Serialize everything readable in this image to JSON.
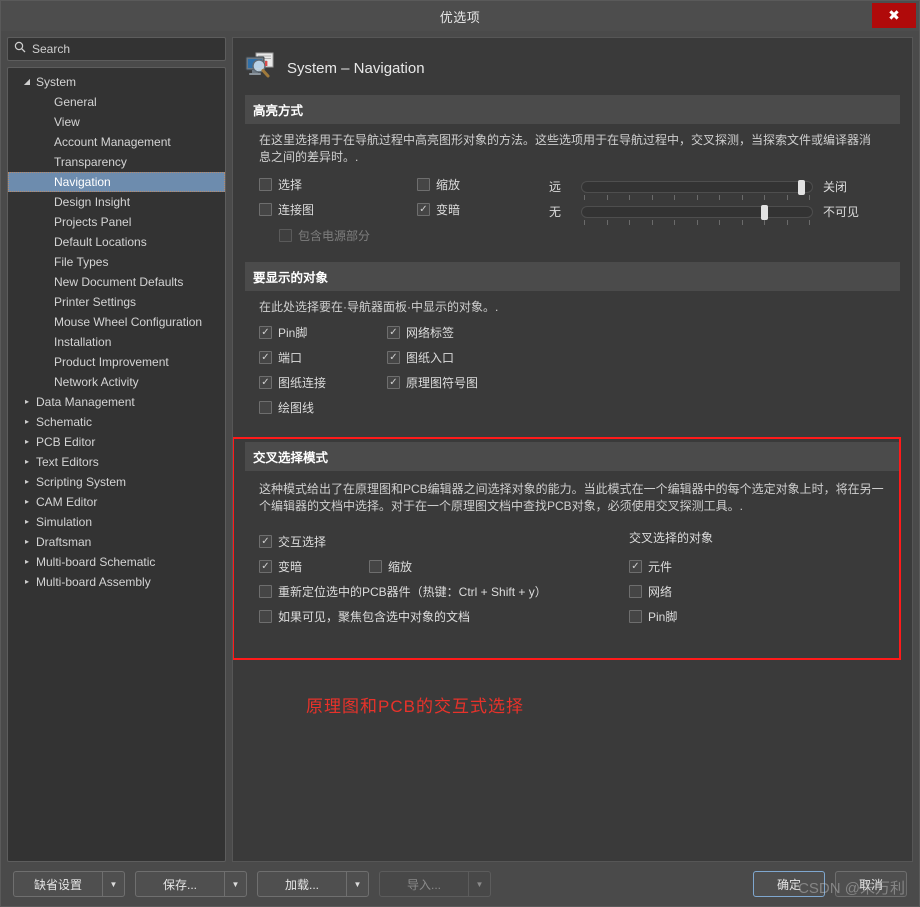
{
  "window": {
    "title": "优选项",
    "close_label": "✖"
  },
  "search": {
    "placeholder": "Search",
    "value": "",
    "icon": "search-icon"
  },
  "sidebar": {
    "items": [
      {
        "label": "System",
        "level": 0,
        "caret": "◢",
        "selected": false
      },
      {
        "label": "General",
        "level": 1,
        "caret": "",
        "selected": false
      },
      {
        "label": "View",
        "level": 1,
        "caret": "",
        "selected": false
      },
      {
        "label": "Account Management",
        "level": 1,
        "caret": "",
        "selected": false
      },
      {
        "label": "Transparency",
        "level": 1,
        "caret": "",
        "selected": false
      },
      {
        "label": "Navigation",
        "level": 1,
        "caret": "",
        "selected": true
      },
      {
        "label": "Design Insight",
        "level": 1,
        "caret": "",
        "selected": false
      },
      {
        "label": "Projects Panel",
        "level": 1,
        "caret": "",
        "selected": false
      },
      {
        "label": "Default Locations",
        "level": 1,
        "caret": "",
        "selected": false
      },
      {
        "label": "File Types",
        "level": 1,
        "caret": "",
        "selected": false
      },
      {
        "label": "New Document Defaults",
        "level": 1,
        "caret": "",
        "selected": false
      },
      {
        "label": "Printer Settings",
        "level": 1,
        "caret": "",
        "selected": false
      },
      {
        "label": "Mouse Wheel Configuration",
        "level": 1,
        "caret": "",
        "selected": false
      },
      {
        "label": "Installation",
        "level": 1,
        "caret": "",
        "selected": false
      },
      {
        "label": "Product Improvement",
        "level": 1,
        "caret": "",
        "selected": false
      },
      {
        "label": "Network Activity",
        "level": 1,
        "caret": "",
        "selected": false
      },
      {
        "label": "Data Management",
        "level": 0,
        "caret": "▸",
        "selected": false
      },
      {
        "label": "Schematic",
        "level": 0,
        "caret": "▸",
        "selected": false
      },
      {
        "label": "PCB Editor",
        "level": 0,
        "caret": "▸",
        "selected": false
      },
      {
        "label": "Text Editors",
        "level": 0,
        "caret": "▸",
        "selected": false
      },
      {
        "label": "Scripting System",
        "level": 0,
        "caret": "▸",
        "selected": false
      },
      {
        "label": "CAM Editor",
        "level": 0,
        "caret": "▸",
        "selected": false
      },
      {
        "label": "Simulation",
        "level": 0,
        "caret": "▸",
        "selected": false
      },
      {
        "label": "Draftsman",
        "level": 0,
        "caret": "▸",
        "selected": false
      },
      {
        "label": "Multi-board Schematic",
        "level": 0,
        "caret": "▸",
        "selected": false
      },
      {
        "label": "Multi-board Assembly",
        "level": 0,
        "caret": "▸",
        "selected": false
      }
    ]
  },
  "page": {
    "title": "System – Navigation",
    "icon": "monitor-magnifier-icon"
  },
  "highlight_section": {
    "header": "高亮方式",
    "description": "在这里选择用于在导航过程中高亮图形对象的方法。这些选项用于在导航过程中，交叉探测，当探索文件或编译器消息之间的差异时。.",
    "col_a": [
      {
        "label": "选择",
        "checked": false,
        "disabled": false
      },
      {
        "label": "连接图",
        "checked": false,
        "disabled": false
      }
    ],
    "col_b": [
      {
        "label": "缩放",
        "checked": false,
        "disabled": false
      },
      {
        "label": "变暗",
        "checked": true,
        "disabled": false
      }
    ],
    "sub_option": {
      "label": "包含电源部分",
      "checked": false,
      "disabled": true
    },
    "sliders": [
      {
        "left_label": "远",
        "right_label": "关闭",
        "value_pct": 96
      },
      {
        "left_label": "无",
        "right_label": "不可见",
        "value_pct": 80
      }
    ]
  },
  "objects_section": {
    "header": "要显示的对象",
    "description": "在此处选择要在·导航器面板·中显示的对象。.",
    "col_a": [
      {
        "label": "Pin脚",
        "checked": true
      },
      {
        "label": "端口",
        "checked": true
      },
      {
        "label": "图纸连接",
        "checked": true
      },
      {
        "label": "绘图线",
        "checked": false
      }
    ],
    "col_b": [
      {
        "label": "网络标签",
        "checked": true
      },
      {
        "label": "图纸入口",
        "checked": true
      },
      {
        "label": "原理图符号图",
        "checked": true
      }
    ]
  },
  "cross_select_section": {
    "header": "交叉选择模式",
    "description": "这种模式给出了在原理图和PCB编辑器之间选择对象的能力。当此模式在一个编辑器中的每个选定对象上时，将在另一个编辑器的文档中选择。对于在一个原理图文档中查找PCB对象，必须使用交叉探测工具。.",
    "left_options": [
      {
        "label": "交互选择",
        "checked": true
      },
      {
        "label": "变暗",
        "checked": true
      },
      {
        "label": "重新定位选中的PCB器件（热键：Ctrl + Shift + y）",
        "checked": false
      },
      {
        "label": "如果可见，聚焦包含选中对象的文档",
        "checked": false
      }
    ],
    "mid_option": {
      "label": "缩放",
      "checked": false
    },
    "right_group_title": "交叉选择的对象",
    "right_options": [
      {
        "label": "元件",
        "checked": true
      },
      {
        "label": "网络",
        "checked": false
      },
      {
        "label": "Pin脚",
        "checked": false
      }
    ],
    "annotation": "原理图和PCB的交互式选择",
    "annotation_color": "#e8322a",
    "box_color": "#ff1a1a"
  },
  "footer": {
    "left_buttons": [
      {
        "label": "缺省设置",
        "disabled": false
      },
      {
        "label": "保存...",
        "disabled": false
      },
      {
        "label": "加载...",
        "disabled": false
      },
      {
        "label": "导入...",
        "disabled": true
      }
    ],
    "ok_label": "确定",
    "cancel_label": "取消",
    "watermark": "CSDN @朱万利"
  }
}
